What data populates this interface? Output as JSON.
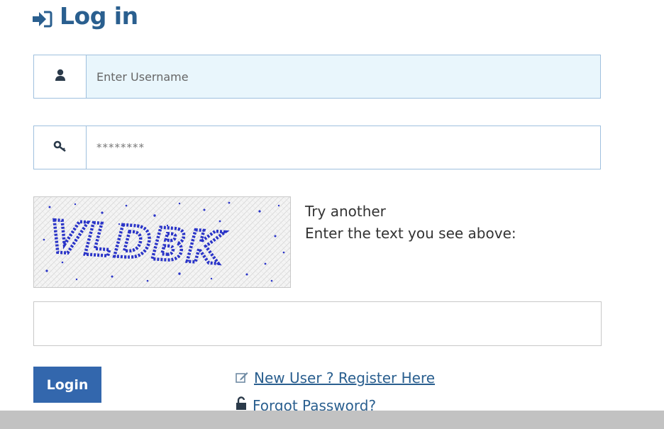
{
  "heading": {
    "icon": "sign-in-icon",
    "text": "Log in"
  },
  "username": {
    "icon": "user-icon",
    "placeholder": "Enter Username",
    "value": ""
  },
  "password": {
    "icon": "key-icon",
    "masked_value": "********"
  },
  "captcha": {
    "image_text": "VLDBK",
    "try_another": "Try another",
    "prompt": "Enter the text you see above:",
    "input_value": ""
  },
  "login_button": {
    "label": "Login"
  },
  "links": {
    "register": {
      "icon": "edit-icon",
      "label": "New User ? Register Here"
    },
    "forgot": {
      "icon": "unlock-icon",
      "label": "Forgot Password?"
    }
  },
  "colors": {
    "accent": "#2a5f8f",
    "button": "#3367ad",
    "field_highlight": "#e9f6fc"
  }
}
